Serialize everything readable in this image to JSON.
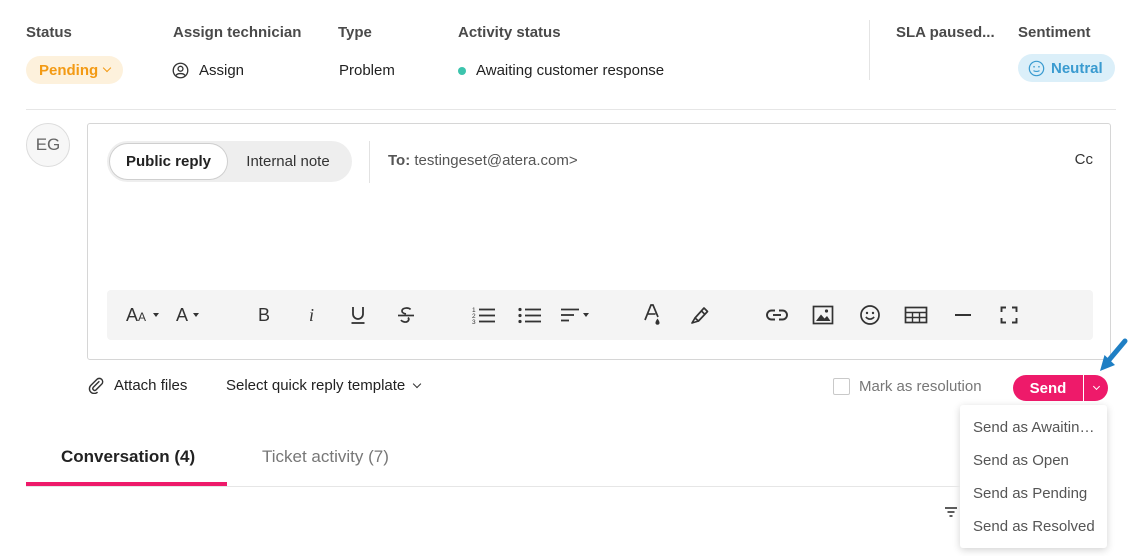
{
  "header": {
    "status": {
      "label": "Status",
      "value": "Pending",
      "color": "#f39a14"
    },
    "technician": {
      "label": "Assign technician",
      "value": "Assign"
    },
    "type": {
      "label": "Type",
      "value": "Problem"
    },
    "activity": {
      "label": "Activity status",
      "value": "Awaiting customer response",
      "dot_color": "#3cc4ad"
    },
    "sla": {
      "label": "SLA paused..."
    },
    "sentiment": {
      "label": "Sentiment",
      "value": "Neutral",
      "color": "#3a9bd0"
    }
  },
  "composer": {
    "avatar_initials": "EG",
    "modes": [
      "Public reply",
      "Internal note"
    ],
    "active_mode": "Public reply",
    "to_label": "To:",
    "to_value": "testingeset@atera.com>",
    "cc_label": "Cc",
    "toolbar_icons": [
      "font-size-icon",
      "font-color-icon",
      "bold-icon",
      "italic-icon",
      "underline-icon",
      "strikethrough-icon",
      "ordered-list-icon",
      "bullet-list-icon",
      "align-icon",
      "text-color-drop-icon",
      "highlight-icon",
      "link-icon",
      "image-icon",
      "emoji-icon",
      "table-icon",
      "horizontal-rule-icon",
      "fullscreen-icon"
    ]
  },
  "actions": {
    "attach_label": "Attach files",
    "template_label": "Select quick reply template",
    "mark_resolution_label": "Mark as resolution",
    "send_label": "Send",
    "accent_color": "#ee1a6a"
  },
  "send_menu": {
    "items": [
      "Send as Awaiting customer response",
      "Send as Open",
      "Send as Pending",
      "Send as Resolved"
    ]
  },
  "tabs": {
    "conversation": "Conversation (4)",
    "activity": "Ticket activity (7)"
  }
}
